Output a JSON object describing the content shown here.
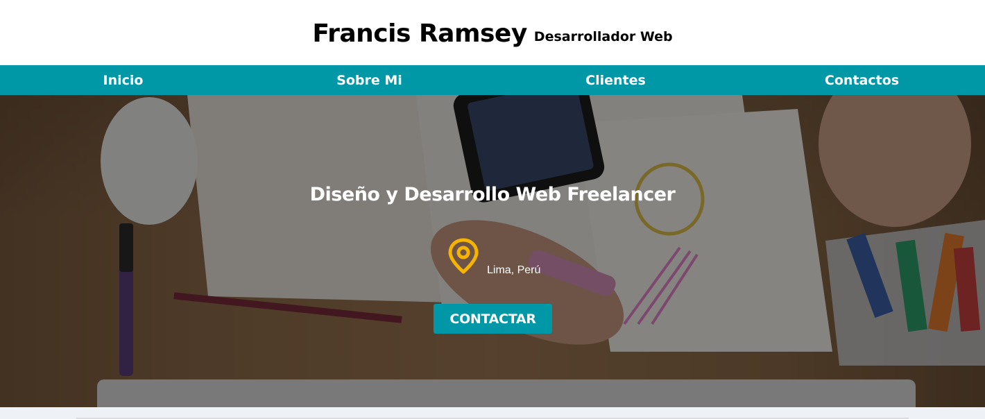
{
  "header": {
    "name": "Francis Ramsey",
    "role": "Desarrollador Web"
  },
  "nav": {
    "items": [
      {
        "label": "Inicio"
      },
      {
        "label": "Sobre Mi"
      },
      {
        "label": "Clientes"
      },
      {
        "label": "Contactos"
      }
    ]
  },
  "hero": {
    "title": "Diseño y Desarrollo Web Freelancer",
    "location": "Lima, Perú",
    "location_icon": "map-pin-icon",
    "cta_label": "CONTACTAR"
  },
  "colors": {
    "accent": "#0097a7",
    "pin": "#f5b400",
    "nav_text": "#ffffff"
  }
}
